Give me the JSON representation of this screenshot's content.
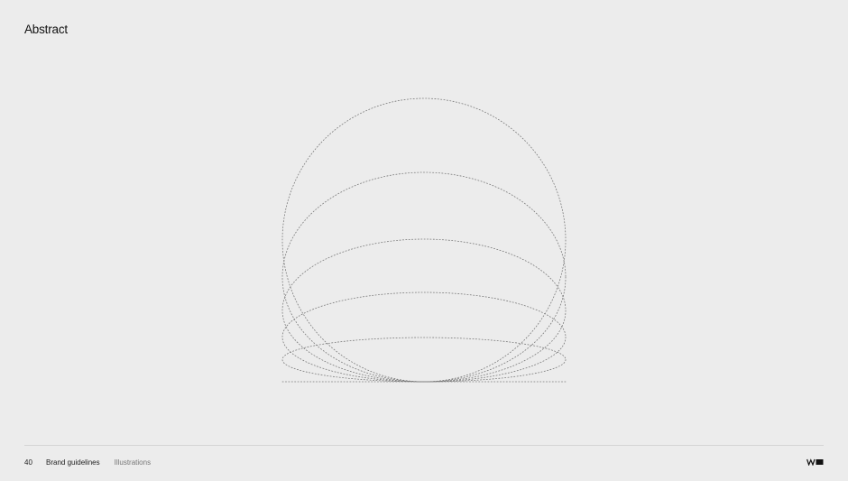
{
  "page": {
    "title": "Abstract"
  },
  "illustration": {
    "icon": "nested-dotted-ellipses",
    "stroke_color": "#7a7a7a"
  },
  "footer": {
    "page_number": "40",
    "document": "Brand guidelines",
    "section": "Illustrations"
  },
  "logo": {
    "icon": "wm-logo-mark",
    "color": "#111111"
  }
}
